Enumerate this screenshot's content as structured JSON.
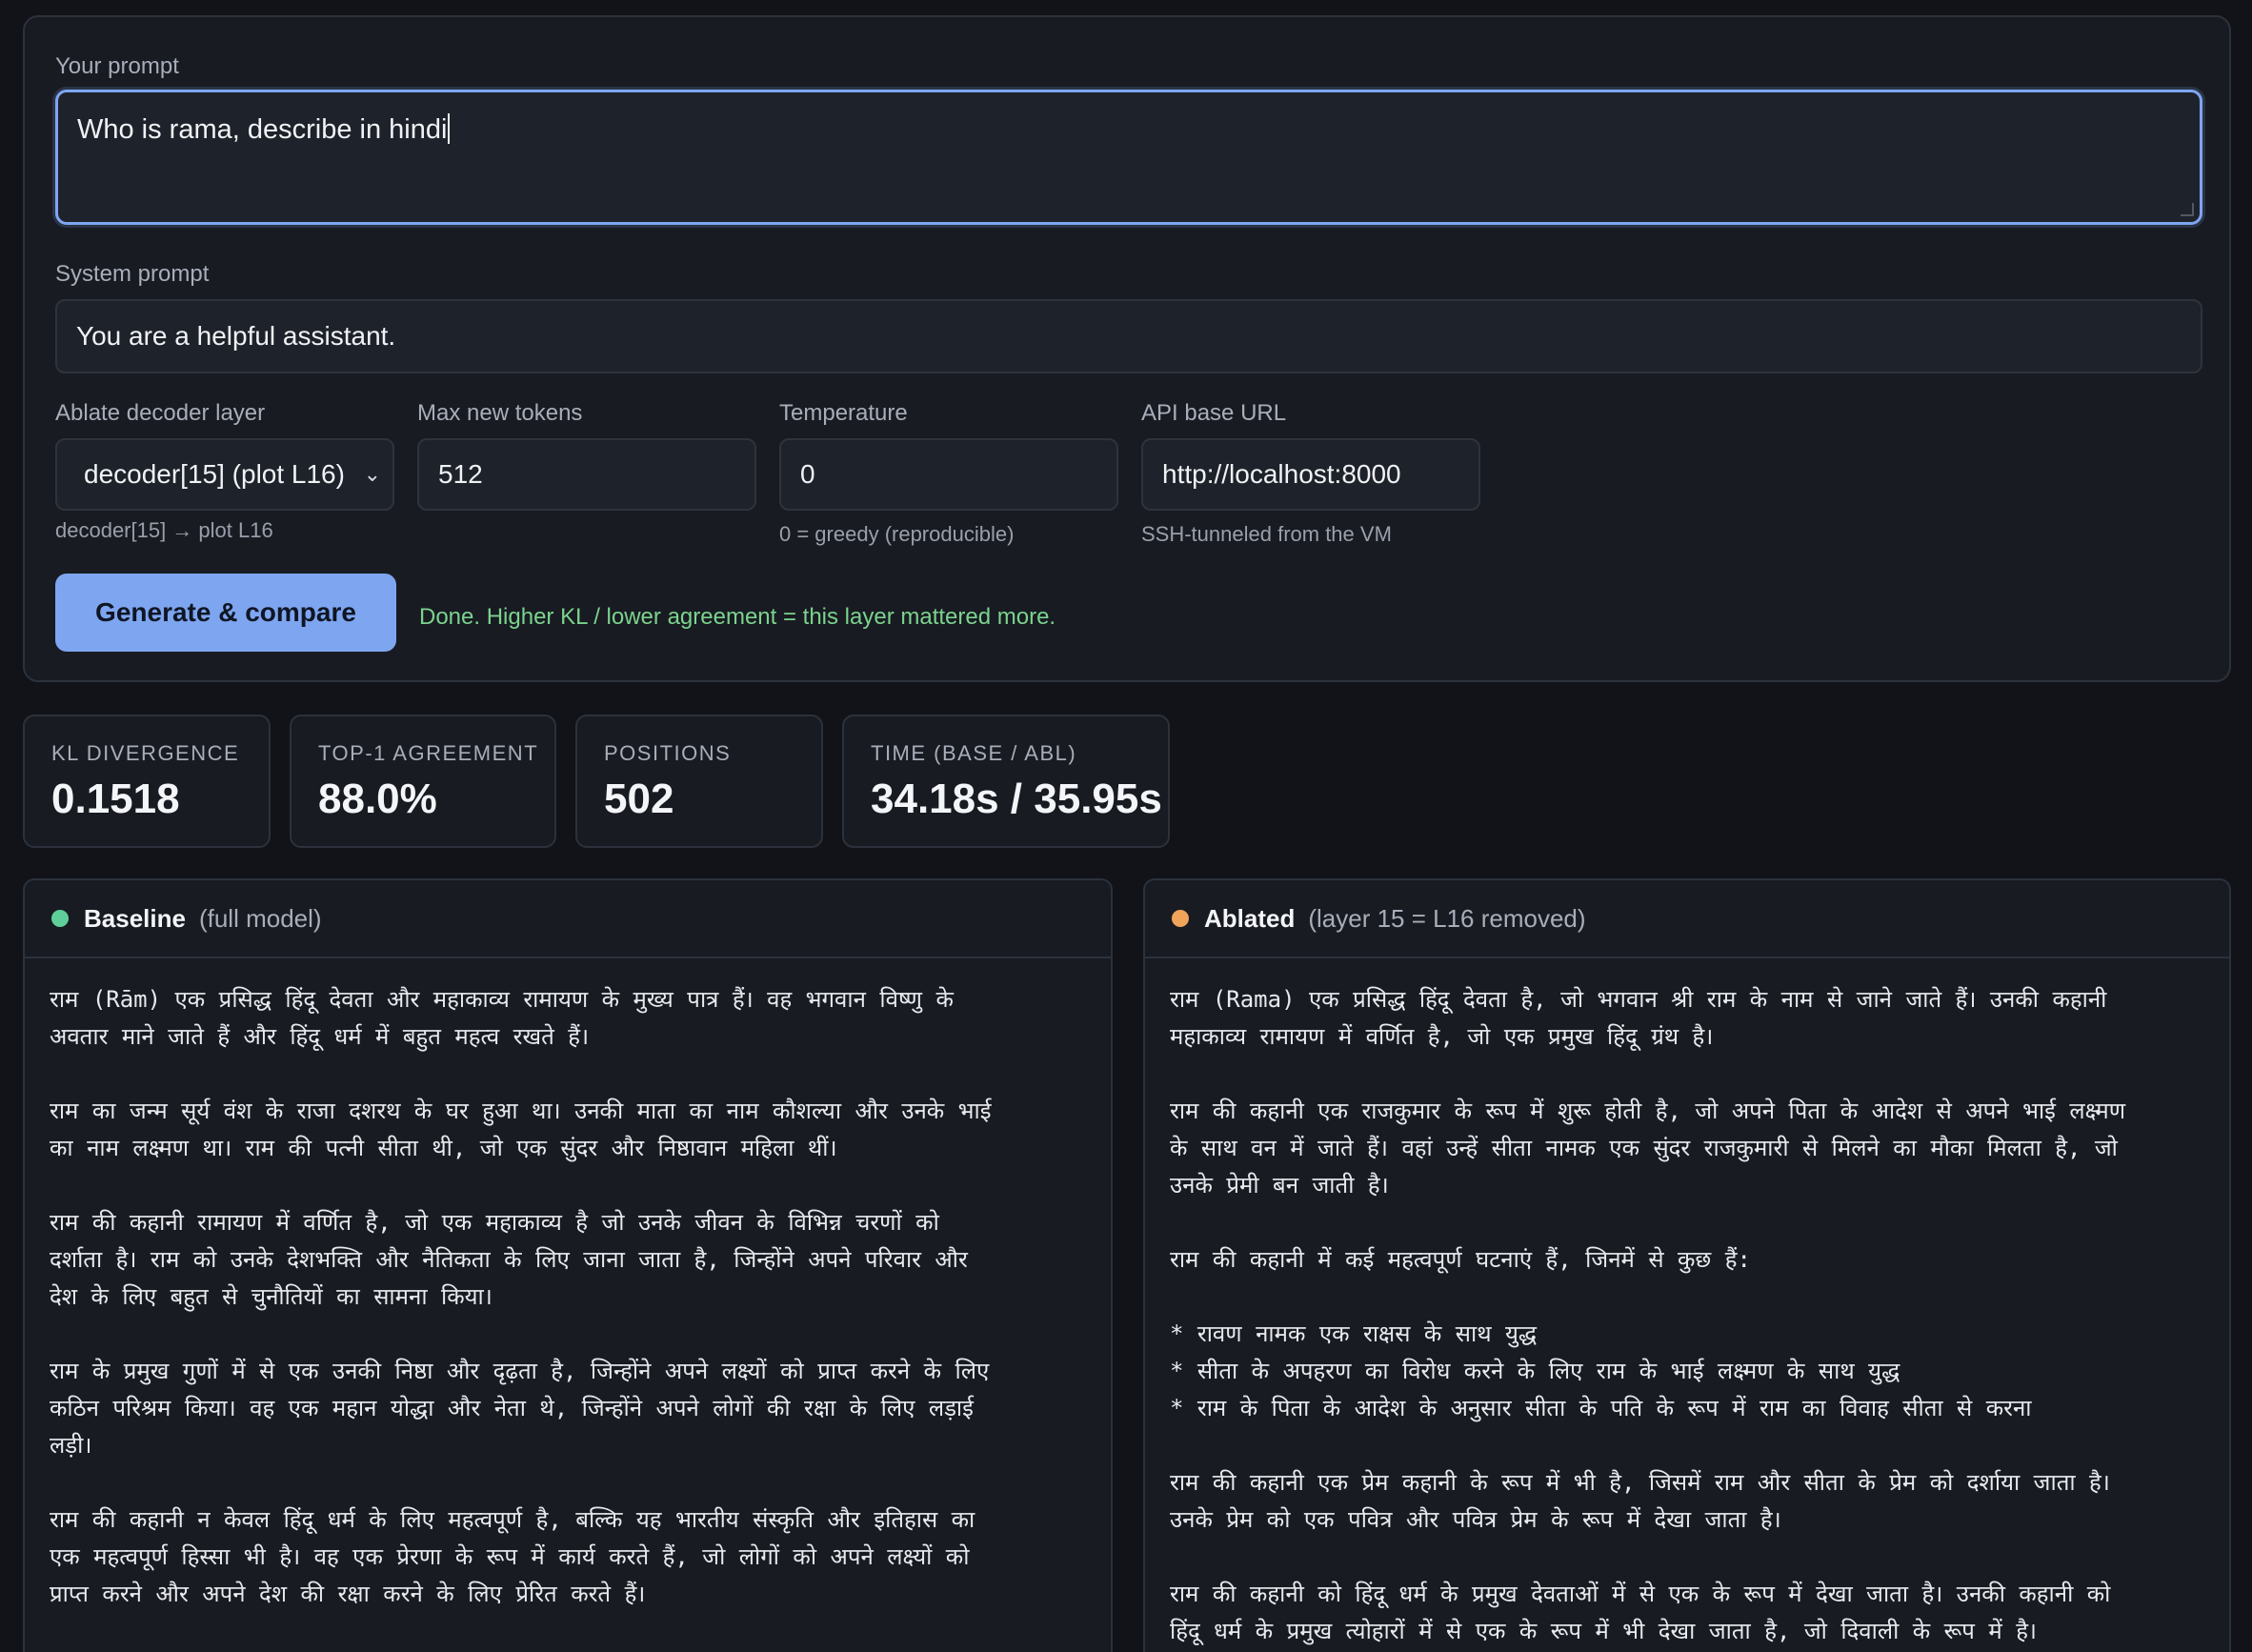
{
  "form": {
    "prompt_label": "Your prompt",
    "prompt_value": "Who is rama, describe in hindi",
    "system_label": "System prompt",
    "system_value": "You are a helpful assistant.",
    "layer_label": "Ablate decoder layer",
    "layer_value": "decoder[15] (plot L16)",
    "layer_help": "decoder[15] → plot L16",
    "tokens_label": "Max new tokens",
    "tokens_value": "512",
    "temp_label": "Temperature",
    "temp_value": "0",
    "temp_help": "0 = greedy (reproducible)",
    "api_label": "API base URL",
    "api_value": "http://localhost:8000",
    "api_help": "SSH-tunneled from the VM",
    "generate_label": "Generate & compare",
    "status": "Done. Higher KL / lower agreement = this layer mattered more."
  },
  "stats": [
    {
      "key": "KL DIVERGENCE",
      "value": "0.1518"
    },
    {
      "key": "TOP-1 AGREEMENT",
      "value": "88.0%"
    },
    {
      "key": "POSITIONS",
      "value": "502"
    },
    {
      "key": "TIME (BASE / ABL)",
      "value": "34.18s / 35.95s"
    }
  ],
  "colors": {
    "accent": "#7ea5f0",
    "baseline_dot": "#5fcf9a",
    "ablated_dot": "#f0a45a",
    "status_green": "#7bd38d"
  },
  "baseline": {
    "title": "Baseline",
    "subtitle": "(full model)",
    "text": "राम (Rām) एक प्रसिद्ध हिंदू देवता और महाकाव्य रामायण के मुख्य पात्र हैं। वह भगवान विष्णु के\nअवतार माने जाते हैं और हिंदू धर्म में बहुत महत्व रखते हैं।\n\nराम का जन्म सूर्य वंश के राजा दशरथ के घर हुआ था। उनकी माता का नाम कौशल्या और उनके भाई\nका नाम लक्ष्मण था। राम की पत्नी सीता थी, जो एक सुंदर और निष्ठावान महिला थीं।\n\nराम की कहानी रामायण में वर्णित है, जो एक महाकाव्य है जो उनके जीवन के विभिन्न चरणों को\nदर्शाता है। राम को उनके देशभक्ति और नैतिकता के लिए जाना जाता है, जिन्होंने अपने परिवार और\nदेश के लिए बहुत से चुनौतियों का सामना किया।\n\nराम के प्रमुख गुणों में से एक उनकी निष्ठा और दृढ़ता है, जिन्होंने अपने लक्ष्यों को प्राप्त करने के लिए\nकठिन परिश्रम किया। वह एक महान योद्धा और नेता थे, जिन्होंने अपने लोगों की रक्षा के लिए लड़ाई\nलड़ी।\n\nराम की कहानी न केवल हिंदू धर्म के लिए महत्वपूर्ण है, बल्कि यह भारतीय संस्कृति और इतिहास का\nएक महत्वपूर्ण हिस्सा भी है। वह एक प्रेरणा के रूप में कार्य करते हैं, जो लोगों को अपने लक्ष्यों को\nप्राप्त करने और अपने देश की रक्षा करने के लिए प्रेरित करते हैं।"
  },
  "ablated": {
    "title": "Ablated",
    "subtitle": "(layer 15 = L16 removed)",
    "text": "राम (Rama) एक प्रसिद्ध हिंदू देवता है, जो भगवान श्री राम के नाम से जाने जाते हैं। उनकी कहानी\nमहाकाव्य रामायण में वर्णित है, जो एक प्रमुख हिंदू ग्रंथ है।\n\nराम की कहानी एक राजकुमार के रूप में शुरू होती है, जो अपने पिता के आदेश से अपने भाई लक्ष्मण\nके साथ वन में जाते हैं। वहां उन्हें सीता नामक एक सुंदर राजकुमारी से मिलने का मौका मिलता है, जो\nउनके प्रेमी बन जाती है।\n\nराम की कहानी में कई महत्वपूर्ण घटनाएं हैं, जिनमें से कुछ हैं:\n\n* रावण नामक एक राक्षस के साथ युद्ध\n* सीता के अपहरण का विरोध करने के लिए राम के भाई लक्ष्मण के साथ युद्ध\n* राम के पिता के आदेश के अनुसार सीता के पति के रूप में राम का विवाह सीता से करना\n\nराम की कहानी एक प्रेम कहानी के रूप में भी है, जिसमें राम और सीता के प्रेम को दर्शाया जाता है।\nउनके प्रेम को एक पवित्र और पवित्र प्रेम के रूप में देखा जाता है।\n\nराम की कहानी को हिंदू धर्म के प्रमुख देवताओं में से एक के रूप में देखा जाता है। उनकी कहानी को\nहिंदू धर्म के प्रमुख त्योहारों में से एक के रूप में भी देखा जाता है, जो दिवाली के रूप में है।"
  }
}
